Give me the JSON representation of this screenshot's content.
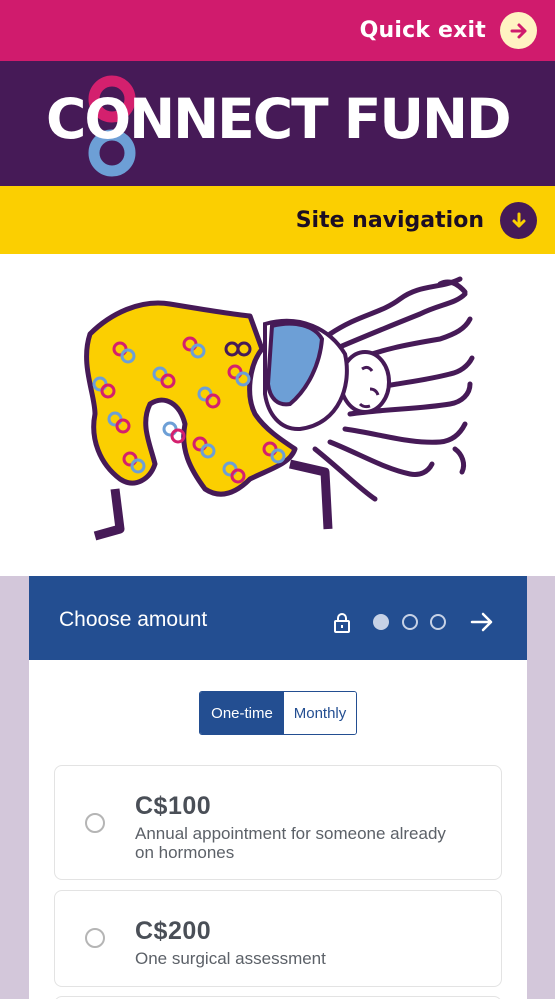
{
  "header": {
    "quick_exit_label": "Quick exit",
    "quick_exit_icon": "arrow-right-icon",
    "brand_name": "CONNECT FUND",
    "site_nav_label": "Site navigation",
    "site_nav_icon": "arrow-down-icon"
  },
  "hero": {
    "illustration": "person-in-patterned-pants-illustration"
  },
  "donation": {
    "title": "Choose amount",
    "secure_icon": "lock-icon",
    "steps": {
      "current": 1,
      "total": 3
    },
    "next_icon": "arrow-right-icon",
    "frequency": {
      "active": "One-time",
      "other": "Monthly"
    },
    "options": [
      {
        "amount": "C$100",
        "description": "Annual appointment for someone already on hormones"
      },
      {
        "amount": "C$200",
        "description": "One surgical assessment"
      }
    ]
  },
  "colors": {
    "magenta": "#d01b6d",
    "purple": "#461a57",
    "yellow": "#fbcf01",
    "blue": "#234e91",
    "lavender": "#d3c7da",
    "logo_pink": "#d4206e",
    "logo_light_blue": "#6d9fd6"
  }
}
